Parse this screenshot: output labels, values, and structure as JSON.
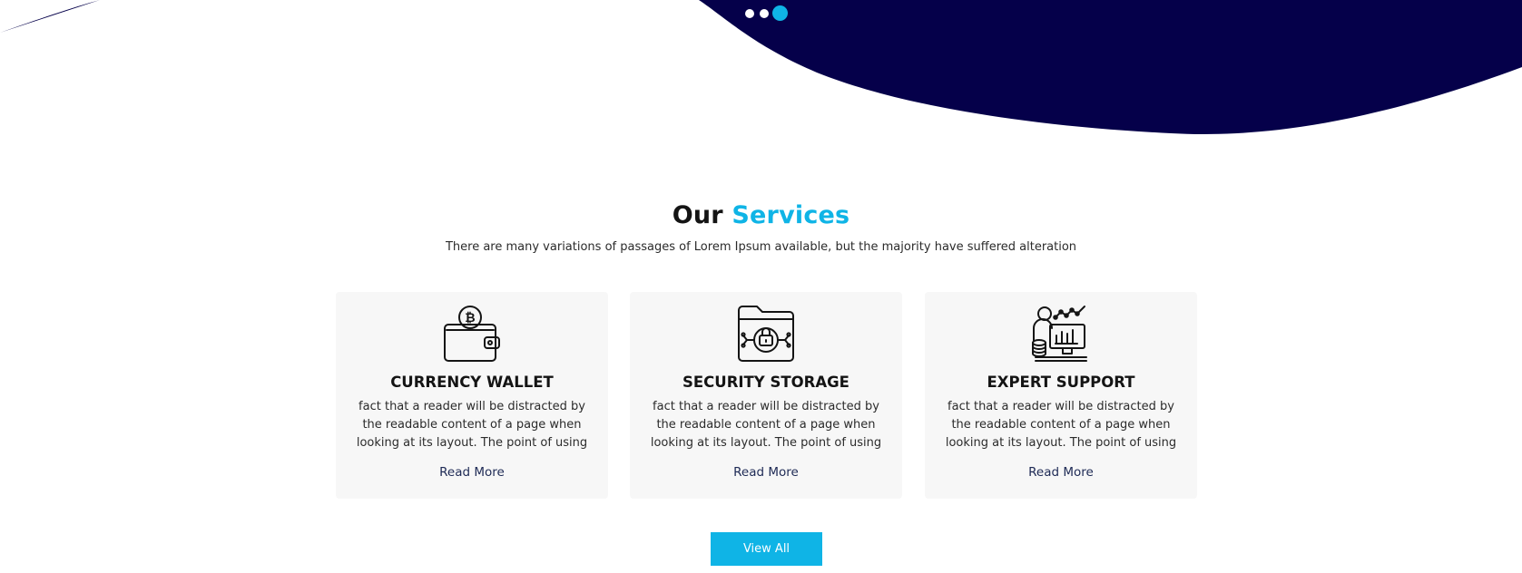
{
  "colors": {
    "hero_bg": "#05004a",
    "accent": "#0fb4e6",
    "card_bg": "#f7f7f7"
  },
  "slider": {
    "dots": [
      "slide-1",
      "slide-2",
      "slide-3"
    ],
    "active_index": 3
  },
  "services": {
    "title_lead": "Our",
    "title_accent": "Services",
    "subtitle": "There are many variations of passages of Lorem Ipsum available, but the majority have suffered alteration",
    "cards": [
      {
        "icon": "bitcoin-wallet-icon",
        "title": "CURRENCY WALLET",
        "text": "fact that a reader will be distracted by the readable content of a page when looking at its layout. The point of using",
        "link": "Read More"
      },
      {
        "icon": "secure-folder-icon",
        "title": "SECURITY STORAGE",
        "text": "fact that a reader will be distracted by the readable content of a page when looking at its layout. The point of using",
        "link": "Read More"
      },
      {
        "icon": "expert-support-icon",
        "title": "EXPERT SUPPORT",
        "text": "fact that a reader will be distracted by the readable content of a page when looking at its layout. The point of using",
        "link": "Read More"
      }
    ],
    "view_all": "View All"
  }
}
